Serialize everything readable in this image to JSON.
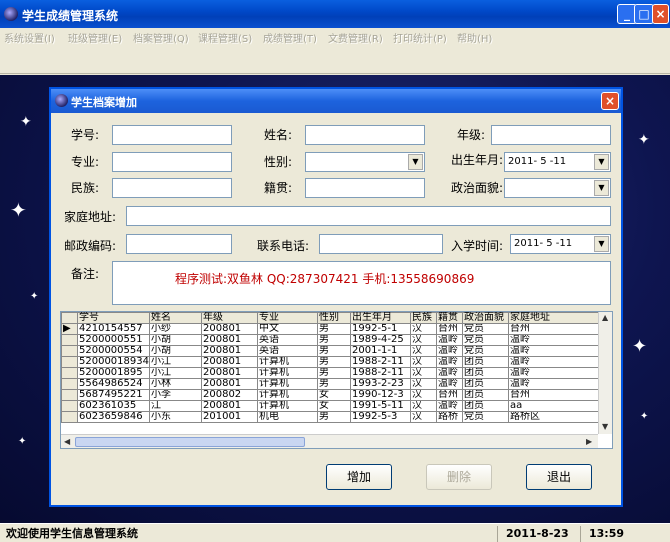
{
  "window": {
    "title": "学生成绩管理系统",
    "btn_min": "_",
    "btn_max": "□",
    "btn_close": "×"
  },
  "menu": [
    "系统设置(I)",
    "班级管理(E)",
    "档案管理(Q)",
    "课程管理(S)",
    "成绩管理(T)",
    "文费管理(R)",
    "打印统计(P)",
    "帮助(H)"
  ],
  "dialog": {
    "title": "学生档案增加",
    "close": "×",
    "labels": {
      "student_id": "学号:",
      "name": "姓名:",
      "grade": "年级:",
      "major": "专业:",
      "gender": "性别:",
      "birth": "出生年月:",
      "ethnicity": "民族:",
      "native_place": "籍贯:",
      "political": "政治面貌:",
      "address": "家庭地址:",
      "postcode": "邮政编码:",
      "phone": "联系电话:",
      "enroll": "入学时间:",
      "note": "备注:"
    },
    "birth_value": "2011- 5 -11",
    "enroll_value": "2011- 5 -11",
    "note_value": "程序测试:双鱼林 QQ:287307421 手机:13558690869",
    "buttons": {
      "add": "增加",
      "delete": "删除",
      "exit": "退出"
    }
  },
  "grid": {
    "columns": [
      "学号",
      "姓名",
      "年级",
      "专业",
      "性别",
      "出生年月",
      "民族",
      "籍贯",
      "政治面貌",
      "家庭地址"
    ],
    "rows": [
      [
        "4210154557",
        "小纱",
        "200801",
        "中文",
        "男",
        "1992-5-1",
        "汉",
        "台州",
        "党员",
        "台州"
      ],
      [
        "5200000551",
        "小胡",
        "200801",
        "英语",
        "男",
        "1989-4-25",
        "汉",
        "温岭",
        "党员",
        "温岭"
      ],
      [
        "5200000554",
        "小胡",
        "200801",
        "英语",
        "男",
        "2001-1-1",
        "汉",
        "温岭",
        "党员",
        "温岭"
      ],
      [
        "52000018934",
        "小江",
        "200801",
        "计算机",
        "男",
        "1988-2-11",
        "汉",
        "温岭",
        "团员",
        "温岭"
      ],
      [
        "5200001895",
        "小江",
        "200801",
        "计算机",
        "男",
        "1988-2-11",
        "汉",
        "温岭",
        "团员",
        "温岭"
      ],
      [
        "5564986524",
        "小林",
        "200801",
        "计算机",
        "男",
        "1993-2-23",
        "汉",
        "温岭",
        "团员",
        "温岭"
      ],
      [
        "5687495221",
        "小李",
        "200802",
        "计算机",
        "女",
        "1990-12-3",
        "汉",
        "台州",
        "团员",
        "台州"
      ],
      [
        "602361035",
        "江",
        "200801",
        "计算机",
        "女",
        "1991-5-11",
        "汉",
        "温岭",
        "团员",
        "aa"
      ],
      [
        "6023659846",
        "小东",
        "201001",
        "机电",
        "男",
        "1992-5-3",
        "汉",
        "路桥",
        "党员",
        "路桥区"
      ]
    ],
    "current_row_marker": "▶"
  },
  "status": {
    "message": "欢迎使用学生信息管理系统",
    "date": "2011-8-23",
    "time": "13:59"
  }
}
